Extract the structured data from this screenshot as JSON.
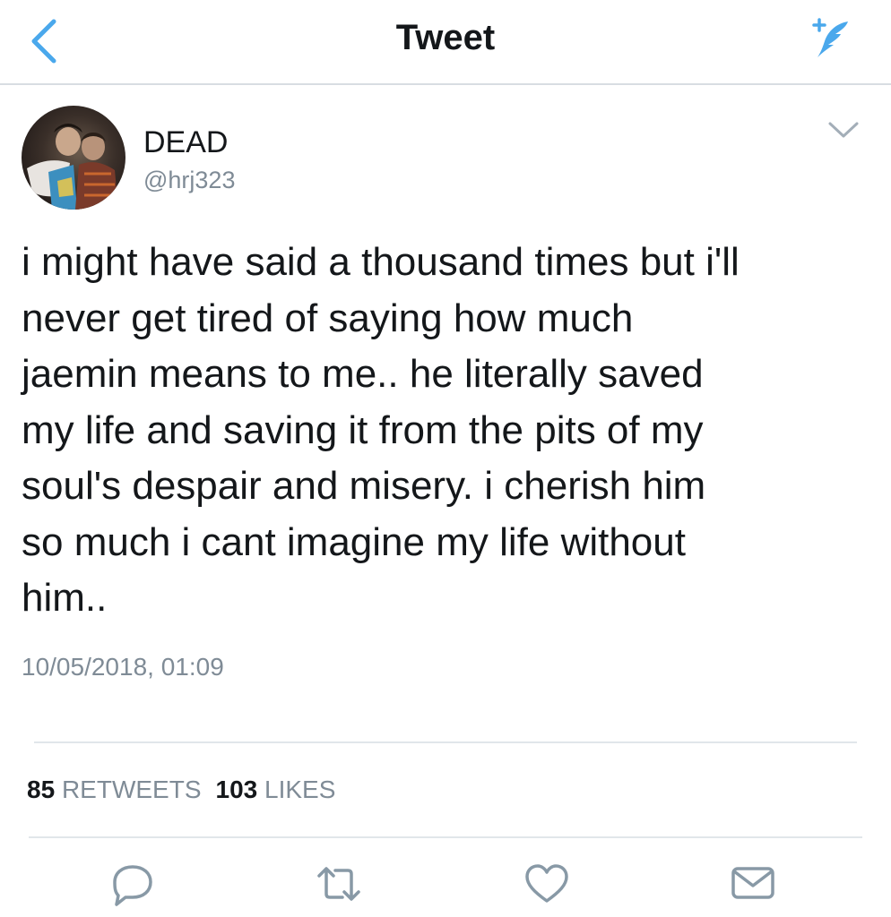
{
  "header": {
    "title": "Tweet",
    "back_icon": "chevron-left-icon",
    "compose_icon": "feather-compose-icon"
  },
  "tweet": {
    "author": {
      "display_name": "DEAD",
      "handle": "@hrj323"
    },
    "text": "i might have said a thousand times but i'll\nnever get tired of saying how much\njaemin means to me.. he literally saved\nmy life and saving it from the pits of my\nsoul's despair and misery. i cherish him\nso much i cant imagine my life without\nhim..",
    "timestamp": "10/05/2018, 01:09",
    "stats": {
      "retweets_count": "85",
      "retweets_label": "RETWEETS",
      "likes_count": "103",
      "likes_label": "LIKES"
    },
    "actions": [
      "reply-icon",
      "retweet-icon",
      "heart-icon",
      "envelope-icon"
    ]
  },
  "colors": {
    "accent": "#1da1f2",
    "text": "#14171a",
    "secondary": "#7f8b96",
    "divider": "#e1e6ea",
    "icon": "#8899a6"
  }
}
